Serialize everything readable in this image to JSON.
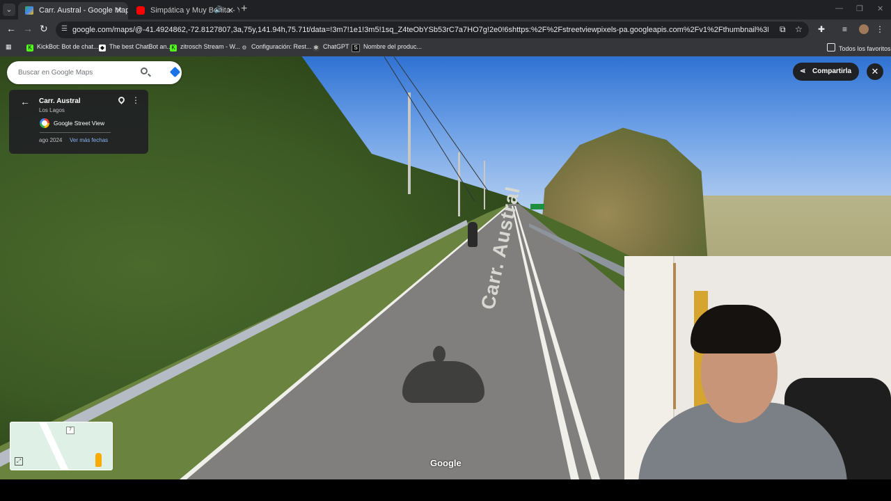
{
  "browser": {
    "tabs": [
      {
        "title": "Carr. Austral - Google Maps",
        "active": true
      },
      {
        "title": "Simpática y Muy Bonita - Yo",
        "active": false
      }
    ],
    "url": "google.com/maps/@-41.4924862,-72.8127807,3a,75y,141.94h,75.71t/data=!3m7!1e1!3m5!1sq_Z4teObYSb53rC7a7HO7g!2e0!6shttps:%2F%2Fstreetviewpixels-pa.googleapis.com%2Fv1%2Fthumbnail%3Fcb_client%3Dmaps_sv.tactile%26w%3D90...",
    "bookmarks": [
      {
        "label": "KickBot: Bot de chat...",
        "icon": "kick-icon",
        "color": "#53fc18"
      },
      {
        "label": "The best ChatBot an...",
        "icon": "chatbot-icon",
        "color": "#ffffff"
      },
      {
        "label": "zitrosch Stream - W...",
        "icon": "kick-icon",
        "color": "#53fc18"
      },
      {
        "label": "Configuración: Rest...",
        "icon": "gear-icon",
        "color": "#cccccc"
      },
      {
        "label": "ChatGPT",
        "icon": "openai-icon",
        "color": "#444444"
      },
      {
        "label": "Nombre del produc...",
        "icon": "s-icon",
        "color": "#111111"
      }
    ],
    "all_favorites": "Todos los favoritos"
  },
  "maps": {
    "search_placeholder": "Buscar en Google Maps",
    "place_title": "Carr. Austral",
    "place_region": "Los Lagos",
    "source": "Google Street View",
    "capture_date": "ago 2024",
    "more_dates": "Ver más fechas",
    "share_label": "Compartirla",
    "minimap_route": "7",
    "road_marking": "Carr. Austral",
    "watermark": "Google"
  },
  "colors": {
    "chrome_dark": "#202124",
    "chrome_mid": "#35363a",
    "accent_link": "#8ab4f8",
    "youtube_red": "#ff0000"
  }
}
